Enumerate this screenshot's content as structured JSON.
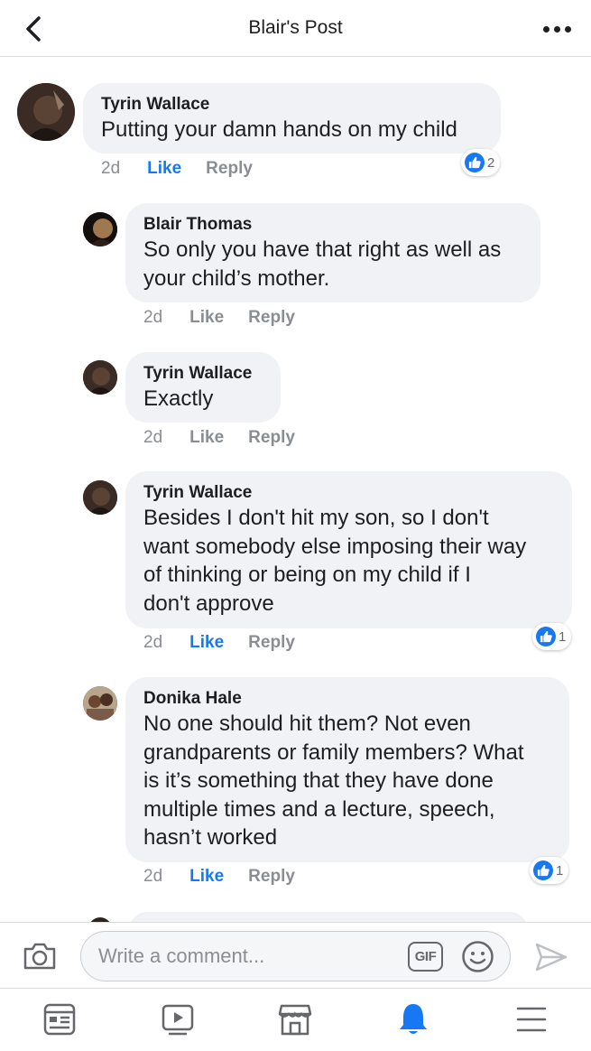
{
  "header": {
    "title": "Blair's Post",
    "back_icon": "chevron-left-icon",
    "more_icon": "more-horizontal-icon"
  },
  "comments": [
    {
      "author": "Tyrin Wallace",
      "text": "Putting your damn hands on my child",
      "time": "2d",
      "like_label": "Like",
      "reply_label": "Reply",
      "liked": true,
      "reactions": "2"
    },
    {
      "author": "Blair Thomas",
      "text": "So only you have that right as well as\nyour child’s mother.",
      "time": "2d",
      "like_label": "Like",
      "reply_label": "Reply",
      "liked": false
    },
    {
      "author": "Tyrin Wallace",
      "text": "Exactly",
      "time": "2d",
      "like_label": "Like",
      "reply_label": "Reply",
      "liked": false
    },
    {
      "author": "Tyrin Wallace",
      "text": "Besides I don't hit my son, so I don't\nwant somebody else imposing their way\nof thinking or being on my child if I\ndon't approve",
      "time": "2d",
      "like_label": "Like",
      "reply_label": "Reply",
      "liked": true,
      "reactions": "1"
    },
    {
      "author": "Donika Hale",
      "text": "No one should hit them? Not even\ngrandparents or family members? What\nis it’s something that they have done\nmultiple times and a lecture, speech,\nhasn’t worked",
      "time": "2d",
      "like_label": "Like",
      "reply_label": "Reply",
      "liked": true,
      "reactions": "1"
    }
  ],
  "composer": {
    "placeholder": "Write a comment...",
    "gif_label": "GIF",
    "camera_icon": "camera-icon",
    "emoji_icon": "emoji-icon",
    "send_icon": "send-icon"
  },
  "tabbar": {
    "icons": [
      "news-feed-icon",
      "watch-icon",
      "marketplace-icon",
      "notifications-icon",
      "menu-icon"
    ],
    "active": "notifications-icon"
  },
  "colors": {
    "accent": "#1877f2",
    "bubble": "#f0f2f5",
    "meta_text": "#8a8d91"
  }
}
